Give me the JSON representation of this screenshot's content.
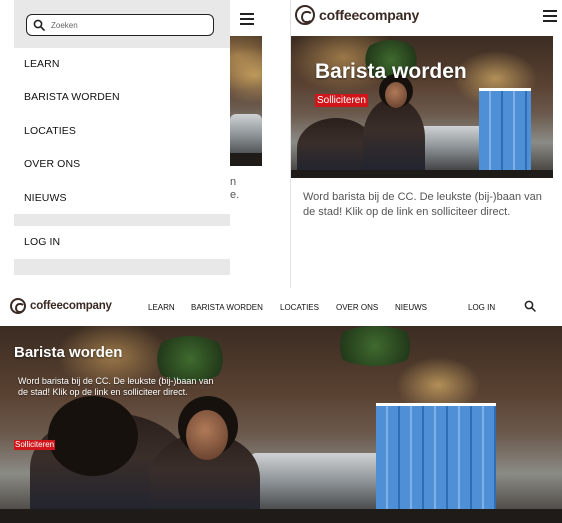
{
  "brand": {
    "name": "coffeecompany",
    "accent_color": "#d0161b",
    "brand_color": "#3a2a23"
  },
  "menu": {
    "search_placeholder": "Zoeken",
    "items": [
      {
        "label": "LEARN"
      },
      {
        "label": "BARISTA WORDEN"
      },
      {
        "label": "LOCATIES"
      },
      {
        "label": "OVER ONS"
      },
      {
        "label": "NIEUWS"
      }
    ],
    "login_label": "LOG IN"
  },
  "mobile": {
    "hero_title": "Barista worden",
    "cta_label": "Solliciteren",
    "description": "Word barista bij de CC. De leukste (bij-)baan van de stad! Klik op de link en solliciteer direct.",
    "behind_text": "n\ne."
  },
  "desktop": {
    "nav": [
      {
        "label": "LEARN"
      },
      {
        "label": "BARISTA WORDEN"
      },
      {
        "label": "LOCATIES"
      },
      {
        "label": "OVER ONS"
      },
      {
        "label": "NIEUWS"
      }
    ],
    "login_label": "LOG IN",
    "hero_title": "Barista worden",
    "hero_description": "Word barista bij de CC. De leukste (bij-)baan van de stad! Klik op de link en solliciteer direct.",
    "cta_label": "Solliciteren"
  },
  "icons": {
    "search": "search-icon",
    "menu": "hamburger-menu-icon",
    "logo": "coffeecompany-logo-icon"
  }
}
